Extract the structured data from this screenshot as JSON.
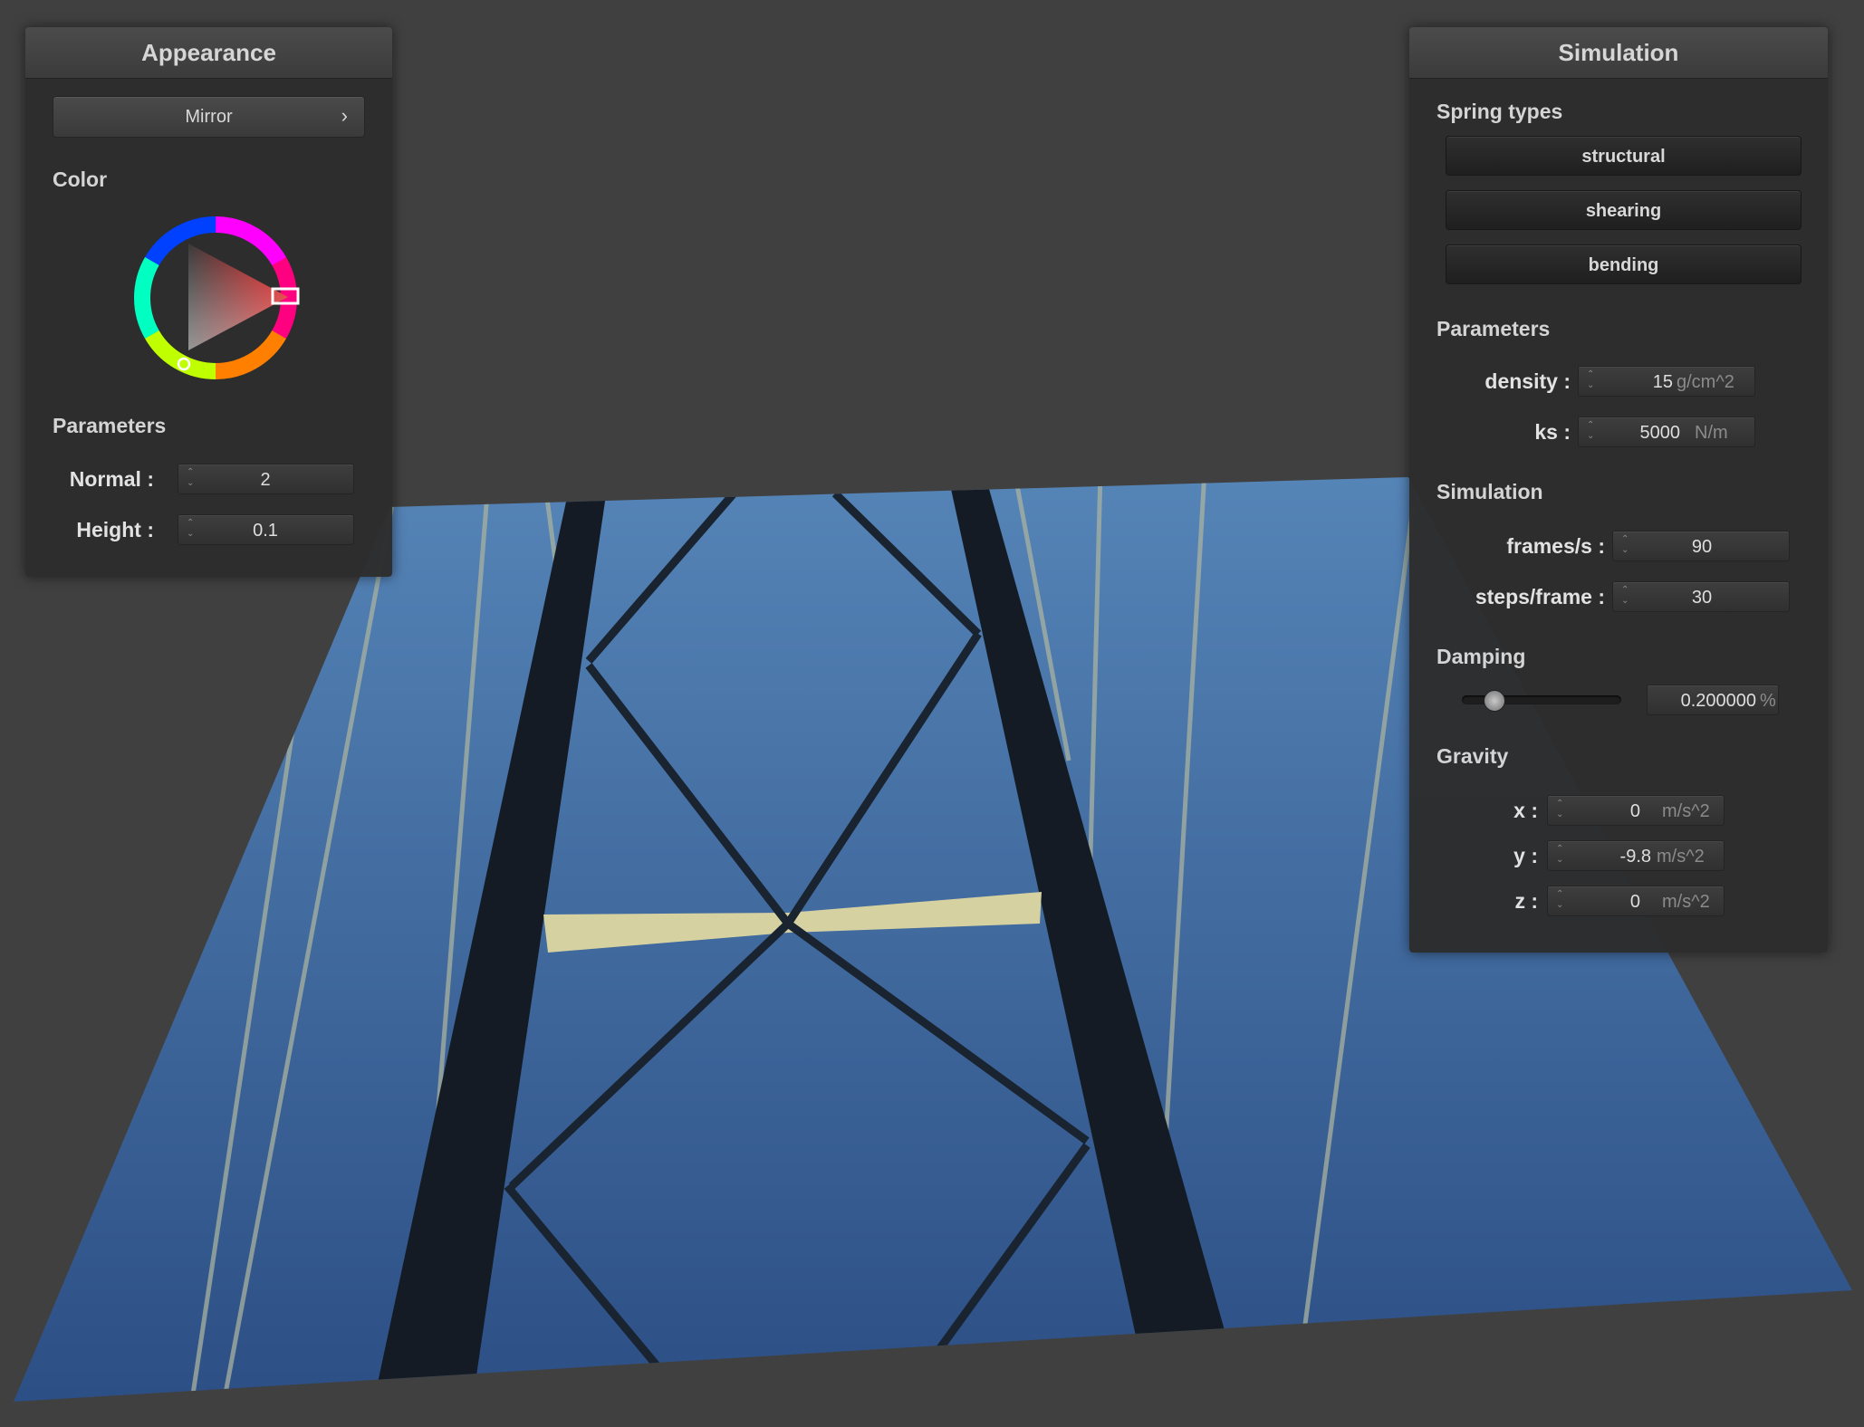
{
  "appearance_panel": {
    "title": "Appearance",
    "shader_button": {
      "label": "Mirror",
      "chevron": "›"
    },
    "color_section": "Color",
    "color_wheel": {
      "selected_color": "#d32020"
    },
    "parameters_section": "Parameters",
    "normal": {
      "label": "Normal :",
      "value": "2"
    },
    "height": {
      "label": "Height :",
      "value": "0.1"
    }
  },
  "simulation_panel": {
    "title": "Simulation",
    "spring_types_section": "Spring types",
    "spring_buttons": [
      "structural",
      "shearing",
      "bending"
    ],
    "parameters_section": "Parameters",
    "density": {
      "label": "density :",
      "value": "15",
      "unit": "g/cm^2"
    },
    "ks": {
      "label": "ks :",
      "value": "5000",
      "unit": "N/m"
    },
    "simulation_section": "Simulation",
    "frames_per_s": {
      "label": "frames/s :",
      "value": "90"
    },
    "steps_per_frame": {
      "label": "steps/frame :",
      "value": "30"
    },
    "damping_section": "Damping",
    "damping": {
      "value": "0.200000",
      "unit": "%",
      "slider_fraction": 0.2
    },
    "gravity_section": "Gravity",
    "gravity_x": {
      "label": "x :",
      "value": "0",
      "unit": "m/s^2"
    },
    "gravity_y": {
      "label": "y :",
      "value": "-9.8",
      "unit": "m/s^2"
    },
    "gravity_z": {
      "label": "z :",
      "value": "0",
      "unit": "m/s^2"
    }
  },
  "colors": {
    "background": "#404040",
    "panel": "#2c2c2c",
    "sky_top": "#5282b6",
    "sky_bottom": "#2d5084",
    "bridge_steel": "#121a22",
    "crossbeam": "#d8d4a0"
  }
}
